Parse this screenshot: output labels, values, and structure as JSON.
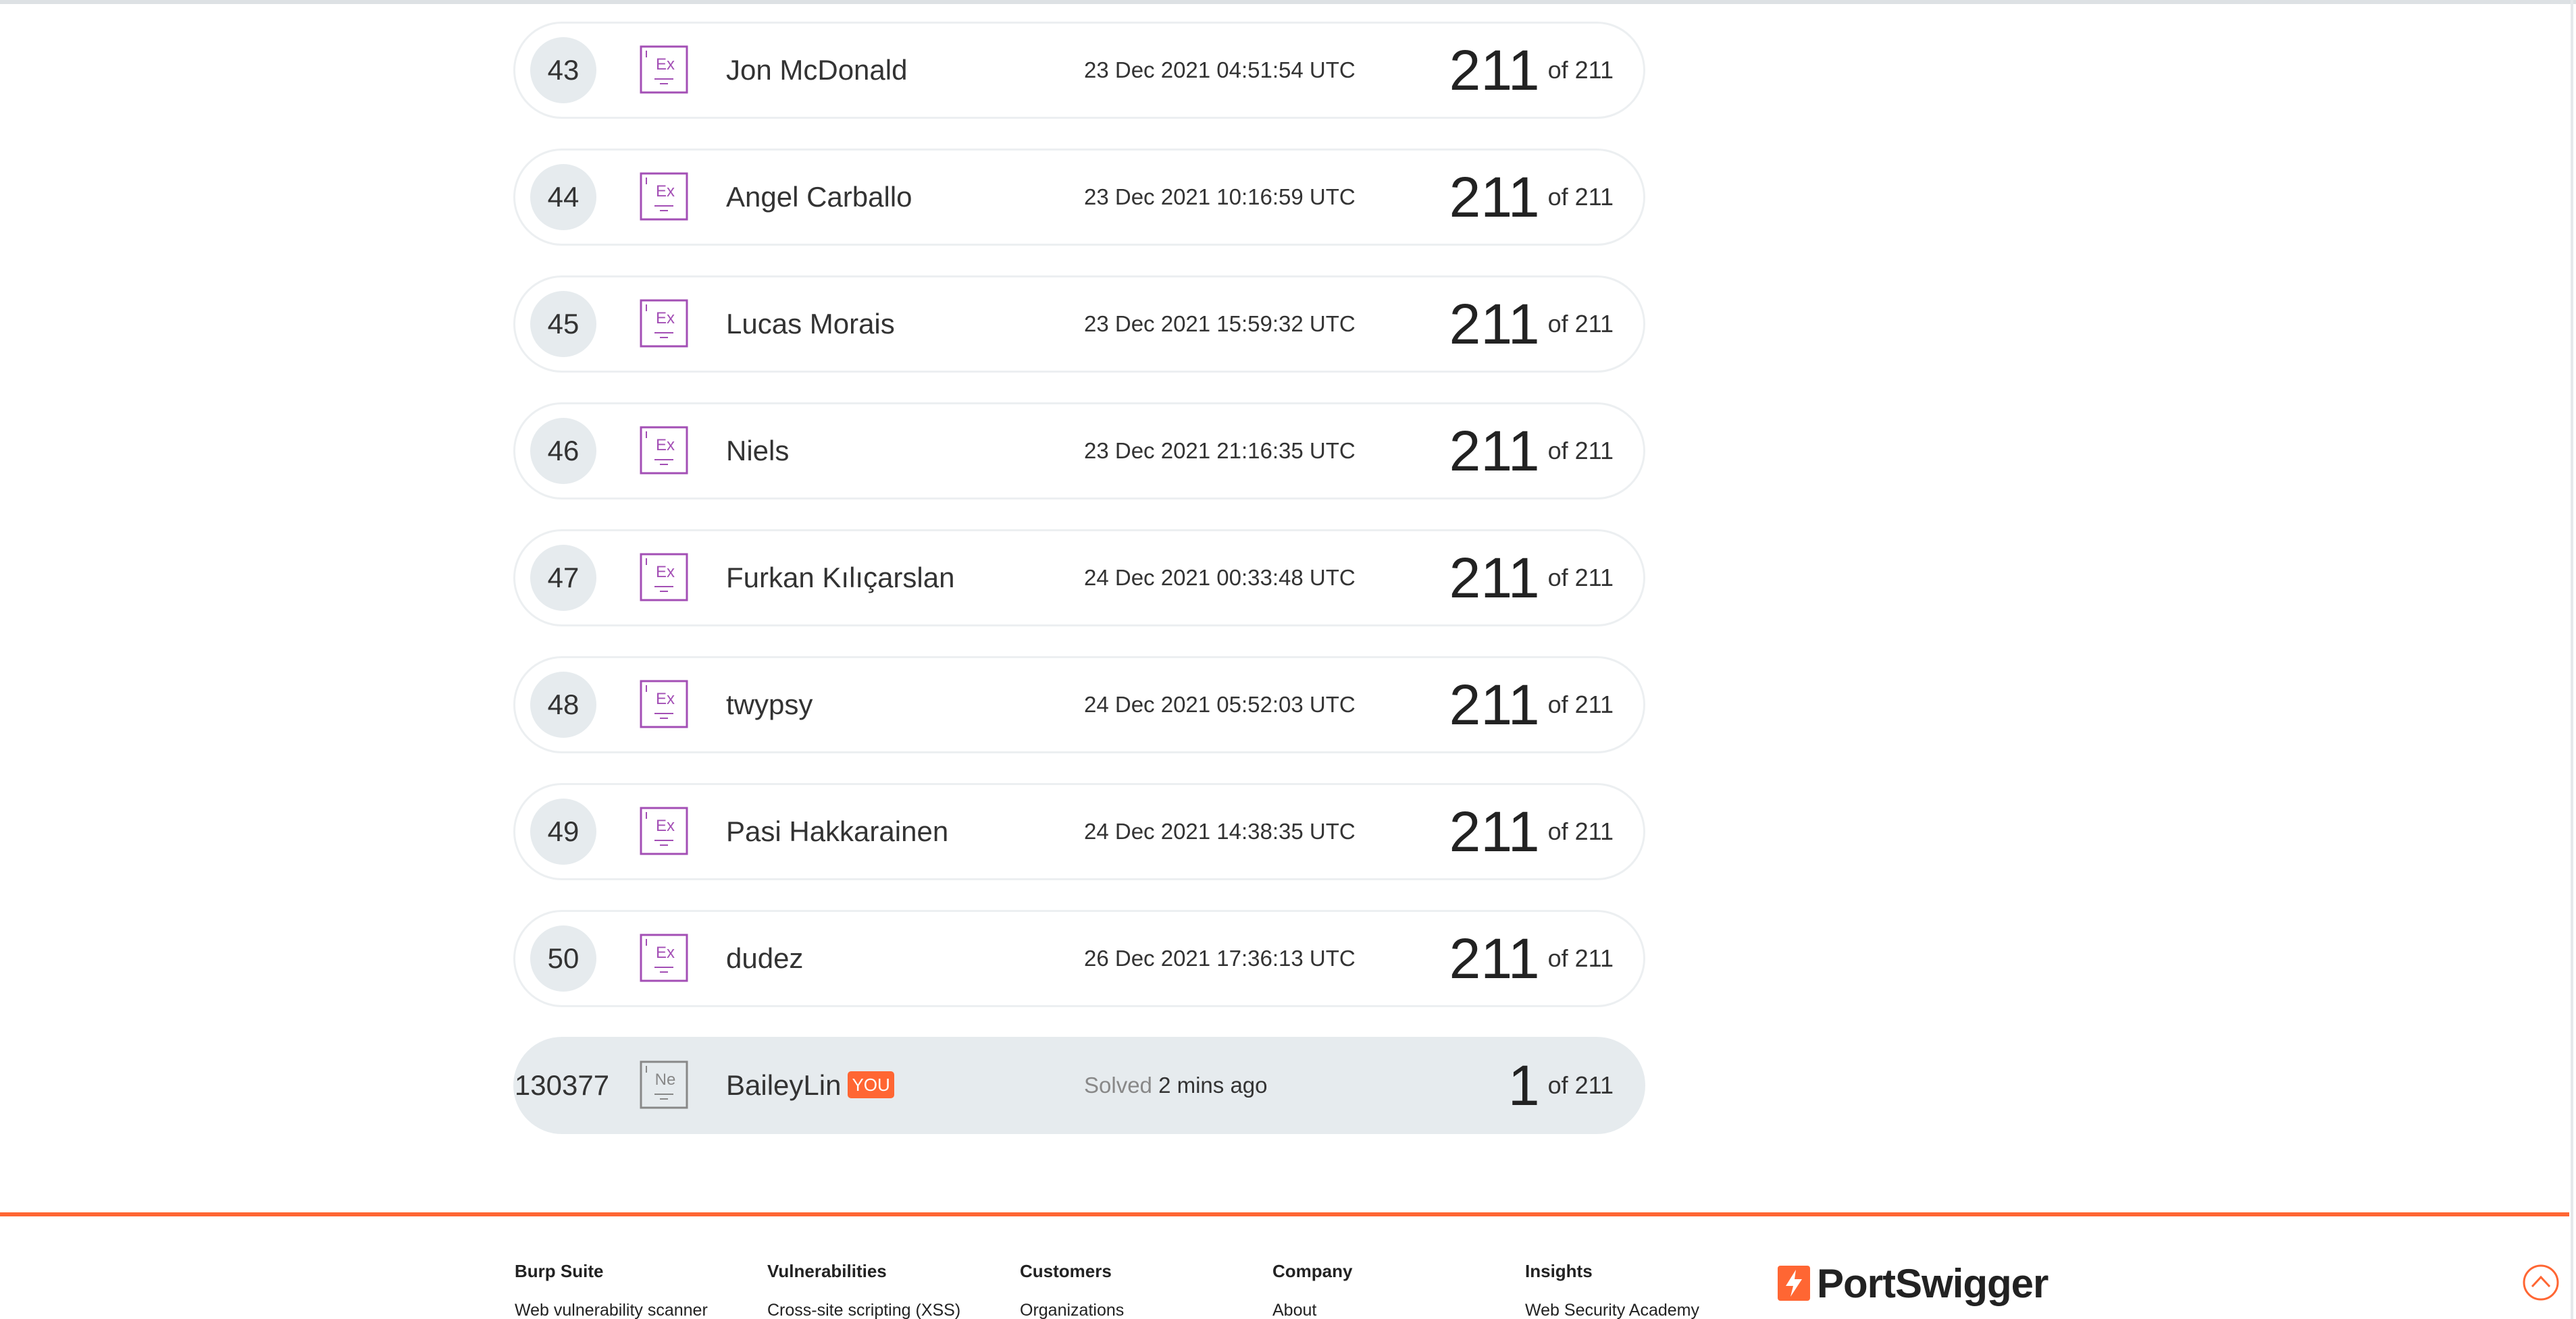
{
  "leaderboard": {
    "rows": [
      {
        "rank": "43",
        "badge": "Ex",
        "name": "Jon McDonald",
        "time": "23 Dec 2021 04:51:54 UTC",
        "score": "211",
        "of": "of 211"
      },
      {
        "rank": "44",
        "badge": "Ex",
        "name": "Angel Carballo",
        "time": "23 Dec 2021 10:16:59 UTC",
        "score": "211",
        "of": "of 211"
      },
      {
        "rank": "45",
        "badge": "Ex",
        "name": "Lucas Morais",
        "time": "23 Dec 2021 15:59:32 UTC",
        "score": "211",
        "of": "of 211"
      },
      {
        "rank": "46",
        "badge": "Ex",
        "name": "Niels",
        "time": "23 Dec 2021 21:16:35 UTC",
        "score": "211",
        "of": "of 211"
      },
      {
        "rank": "47",
        "badge": "Ex",
        "name": "Furkan Kılıçarslan",
        "time": "24 Dec 2021 00:33:48 UTC",
        "score": "211",
        "of": "of 211"
      },
      {
        "rank": "48",
        "badge": "Ex",
        "name": "twypsy",
        "time": "24 Dec 2021 05:52:03 UTC",
        "score": "211",
        "of": "of 211"
      },
      {
        "rank": "49",
        "badge": "Ex",
        "name": "Pasi Hakkarainen",
        "time": "24 Dec 2021 14:38:35 UTC",
        "score": "211",
        "of": "of 211"
      },
      {
        "rank": "50",
        "badge": "Ex",
        "name": "dudez",
        "time": "26 Dec 2021 17:36:13 UTC",
        "score": "211",
        "of": "of 211"
      }
    ],
    "you_row": {
      "rank": "130377",
      "badge": "Ne",
      "name": "BaileyLin",
      "you_tag": "YOU",
      "solved_label": "Solved",
      "solved_time": "2 mins ago",
      "score": "1",
      "of": "of 211"
    }
  },
  "footer": {
    "columns": [
      {
        "heading": "Burp Suite",
        "link": "Web vulnerability scanner"
      },
      {
        "heading": "Vulnerabilities",
        "link": "Cross-site scripting (XSS)"
      },
      {
        "heading": "Customers",
        "link": "Organizations"
      },
      {
        "heading": "Company",
        "link": "About"
      },
      {
        "heading": "Insights",
        "link": "Web Security Academy"
      }
    ],
    "brand": "PortSwigger",
    "brand_icon": "portswigger-logo-icon",
    "scroll_top_icon": "chevron-up-circle-icon"
  },
  "colors": {
    "expert_badge": "#a34fb5",
    "novice_badge": "#888888",
    "accent": "#ff6633",
    "row_border": "#eceff1",
    "you_row_bg": "#e6ebee"
  }
}
